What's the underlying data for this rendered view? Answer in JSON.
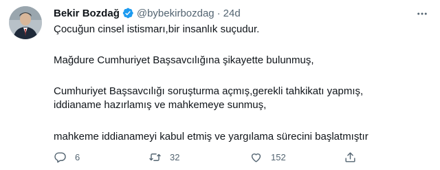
{
  "tweet": {
    "author_name": "Bekir Bozdağ",
    "handle": "@bybekirbozdag",
    "separator": "·",
    "time": "24d",
    "paragraphs": [
      "Çocuğun cinsel istismarı,bir insanlık suçudur.",
      "Mağdure Cumhuriyet Başsavcılığına şikayette bulunmuş,",
      "Cumhuriyet Başsavcılığı soruşturma açmış,gerekli tahkikatı yapmış,\niddianame hazırlamış ve mahkemeye sunmuş,",
      "mahkeme iddianameyi kabul etmiş ve yargılama sürecini başlatmıştır"
    ],
    "reply_count": "6",
    "retweet_count": "32",
    "like_count": "152"
  },
  "icons": {
    "verified": "verified-badge-icon",
    "more": "more-dots-icon",
    "reply": "reply-icon",
    "retweet": "retweet-icon",
    "like": "heart-icon",
    "share": "share-icon"
  },
  "colors": {
    "verified_blue": "#1d9bf0",
    "text_primary": "#0f1419",
    "text_secondary": "#536471"
  }
}
